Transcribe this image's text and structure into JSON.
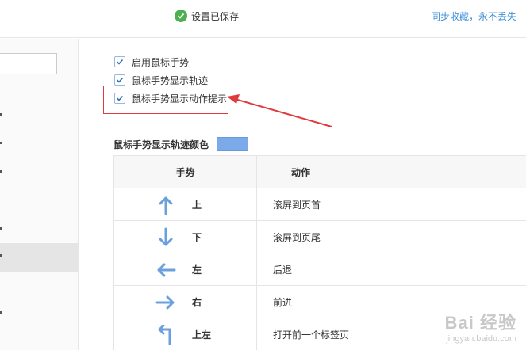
{
  "header": {
    "saved_text": "设置已保存",
    "sync_link": "同步收藏，永不丢失"
  },
  "options": [
    {
      "label": "启用鼠标手势",
      "checked": true
    },
    {
      "label": "鼠标手势显示轨迹",
      "checked": true
    },
    {
      "label": "鼠标手势显示动作提示",
      "checked": true
    }
  ],
  "trail_color": {
    "label": "鼠标手势显示轨迹颜色",
    "color": "#7aaaea"
  },
  "table": {
    "headers": {
      "gesture": "手势",
      "action": "动作"
    },
    "rows": [
      {
        "icon": "arrow-up-icon",
        "gesture": "上",
        "action": "滚屏到页首"
      },
      {
        "icon": "arrow-down-icon",
        "gesture": "下",
        "action": "滚屏到页尾"
      },
      {
        "icon": "arrow-left-icon",
        "gesture": "左",
        "action": "后退"
      },
      {
        "icon": "arrow-right-icon",
        "gesture": "右",
        "action": "前进"
      },
      {
        "icon": "arrow-up-left-icon",
        "gesture": "上左",
        "action": "打开前一个标签页"
      }
    ]
  },
  "watermark": {
    "title": "Bai 经验",
    "sub": "jingyan.baidu.com"
  }
}
